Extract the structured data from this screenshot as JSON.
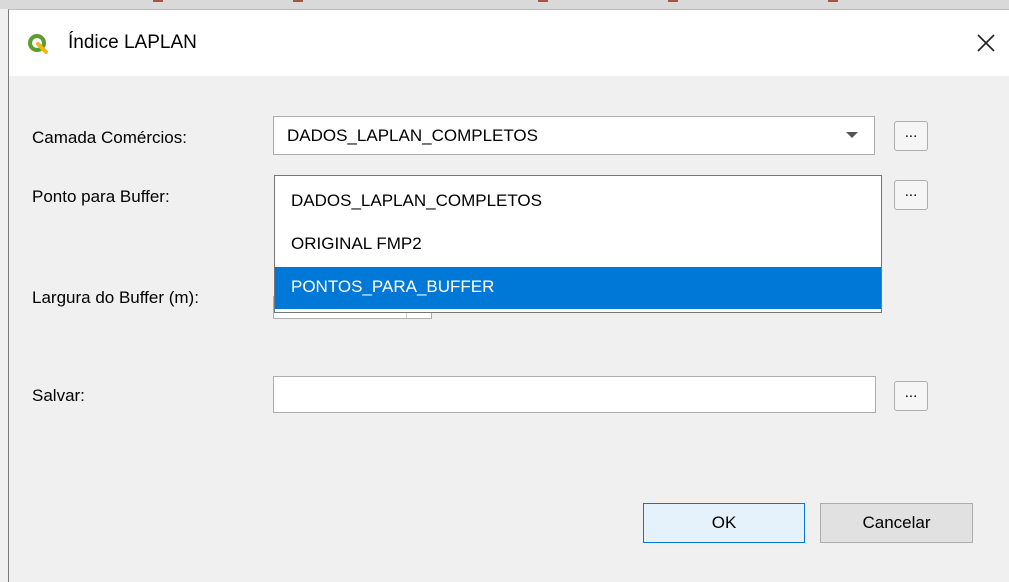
{
  "window": {
    "title": "Índice LAPLAN",
    "app_icon": "qgis-logo-icon",
    "close_icon": "close-icon"
  },
  "form": {
    "camada_label": "Camada Comércios:",
    "camada_value": "DADOS_LAPLAN_COMPLETOS",
    "ponto_label": "Ponto para Buffer:",
    "largura_label": "Largura do Buffer (m):",
    "salvar_label": "Salvar:",
    "salvar_value": "",
    "browse_label": "..."
  },
  "dropdown": {
    "options": [
      "DADOS_LAPLAN_COMPLETOS",
      "ORIGINAL FMP2",
      "PONTOS_PARA_BUFFER"
    ],
    "selected_index": 2
  },
  "buttons": {
    "ok": "OK",
    "cancel": "Cancelar"
  },
  "colors": {
    "selection": "#0078d7",
    "qgis_green": "#5a9e2f",
    "qgis_yellow": "#f0b41c"
  }
}
